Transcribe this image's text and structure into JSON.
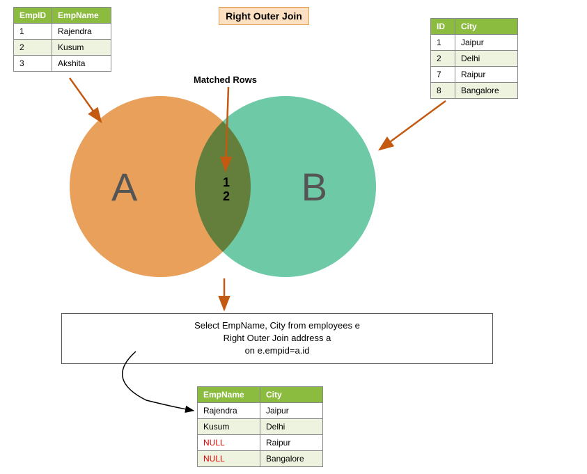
{
  "title": "Right Outer Join",
  "matched_label": "Matched Rows",
  "circle_a_label": "A",
  "circle_b_label": "B",
  "overlap_values": [
    "1",
    "2"
  ],
  "table_a": {
    "headers": [
      "EmpID",
      "EmpName"
    ],
    "rows": [
      {
        "c0": "1",
        "c1": "Rajendra"
      },
      {
        "c0": "2",
        "c1": "Kusum"
      },
      {
        "c0": "3",
        "c1": "Akshita"
      }
    ]
  },
  "table_b": {
    "headers": [
      "ID",
      "City"
    ],
    "rows": [
      {
        "c0": "1",
        "c1": "Jaipur"
      },
      {
        "c0": "2",
        "c1": "Delhi"
      },
      {
        "c0": "7",
        "c1": "Raipur"
      },
      {
        "c0": "8",
        "c1": "Bangalore"
      }
    ]
  },
  "sql": {
    "line1": "Select EmpName, City from employees e",
    "line2": "Right Outer Join address a",
    "line3": "on e.empid=a.id"
  },
  "table_result": {
    "headers": [
      "EmpName",
      "City"
    ],
    "rows": [
      {
        "c0": "Rajendra",
        "c1": "Jaipur",
        "null0": false
      },
      {
        "c0": "Kusum",
        "c1": "Delhi",
        "null0": false
      },
      {
        "c0": "NULL",
        "c1": "Raipur",
        "null0": true
      },
      {
        "c0": "NULL",
        "c1": "Bangalore",
        "null0": true
      }
    ]
  },
  "chart_data": {
    "type": "venn-diagram",
    "sets": [
      {
        "name": "A",
        "label": "employees",
        "items": [
          "1",
          "2",
          "3"
        ],
        "color": "#e8a05a"
      },
      {
        "name": "B",
        "label": "address",
        "items": [
          "1",
          "2",
          "7",
          "8"
        ],
        "color": "#6ec9a6"
      }
    ],
    "intersection": [
      "1",
      "2"
    ],
    "title": "Right Outer Join",
    "annotations": [
      "Matched Rows"
    ]
  }
}
